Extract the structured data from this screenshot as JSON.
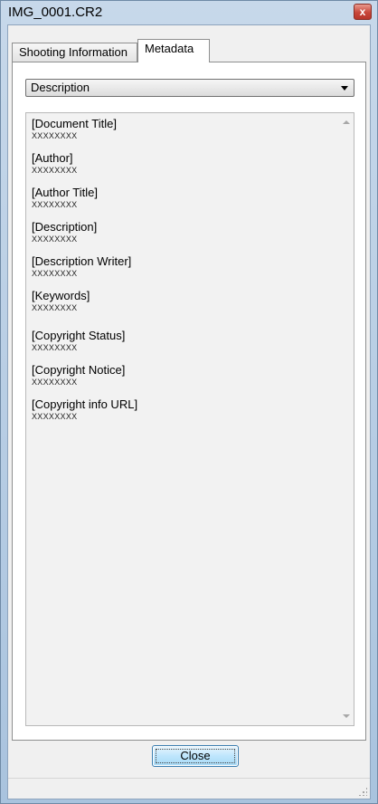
{
  "window": {
    "title": "IMG_0001.CR2",
    "close_glyph": "x"
  },
  "tabs": [
    {
      "label": "Shooting Information",
      "active": false
    },
    {
      "label": "Metadata",
      "active": true
    }
  ],
  "category_select": {
    "value": "Description"
  },
  "metadata_entries": [
    {
      "label": "[Document Title]",
      "value": "XXXXXXXX"
    },
    {
      "label": "[Author]",
      "value": "XXXXXXXX"
    },
    {
      "label": "[Author Title]",
      "value": "XXXXXXXX"
    },
    {
      "label": "[Description]",
      "value": "XXXXXXXX"
    },
    {
      "label": "[Description Writer]",
      "value": "XXXXXXXX"
    },
    {
      "label": "[Keywords]",
      "value": "XXXXXXXX"
    },
    {
      "label": "[Copyright Status]",
      "value": "XXXXXXXX"
    },
    {
      "label": "[Copyright Notice]",
      "value": "XXXXXXXX"
    },
    {
      "label": "[Copyright info URL]",
      "value": "XXXXXXXX"
    }
  ],
  "footer": {
    "close_label": "Close"
  },
  "icons": {
    "window_close": "close-icon",
    "dropdown": "chevron-down-icon",
    "scroll_up": "scroll-up-arrow-icon",
    "scroll_down": "scroll-down-arrow-icon",
    "resize": "resize-grip-icon"
  },
  "colors": {
    "title_bar": "#b8cfe6",
    "close_button_red": "#c8473a",
    "list_background": "#f2f2f2",
    "default_button": "#bee6fd"
  }
}
